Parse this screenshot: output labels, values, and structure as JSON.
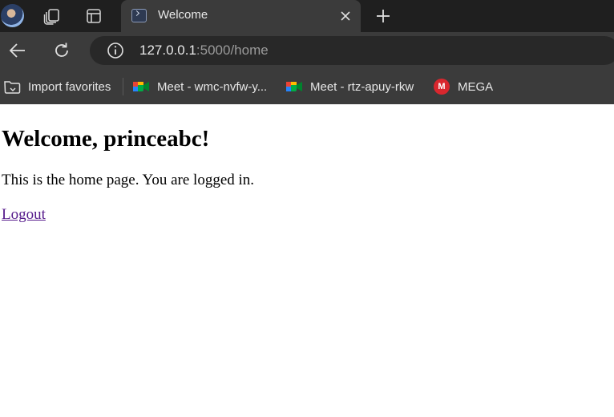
{
  "browser": {
    "tab": {
      "title": "Welcome",
      "close_icon": "close-icon",
      "favicon": "terminal-icon"
    },
    "tabbar_icons": [
      "profile-avatar",
      "workspaces-icon",
      "vertical-tabs-icon",
      "new-tab-icon"
    ],
    "address": {
      "host": "127.0.0.1",
      "rest": ":5000/home"
    },
    "bookmarks": [
      {
        "label": "Import favorites",
        "icon": "import-favorites-icon"
      },
      {
        "label": "Meet - wmc-nvfw-y...",
        "icon": "google-meet-icon"
      },
      {
        "label": "Meet - rtz-apuy-rkw",
        "icon": "google-meet-icon"
      },
      {
        "label": "MEGA",
        "icon": "mega-icon",
        "icon_letter": "M"
      }
    ],
    "colors": {
      "tabbar": "#1f1f1f",
      "toolbar": "#3b3b3b",
      "omnibox": "#282828",
      "mega_red": "#d9272e"
    }
  },
  "page": {
    "heading": "Welcome, princeabc!",
    "message": "This is the home page. You are logged in.",
    "logout_link": "Logout",
    "link_color": "#551a8b"
  }
}
